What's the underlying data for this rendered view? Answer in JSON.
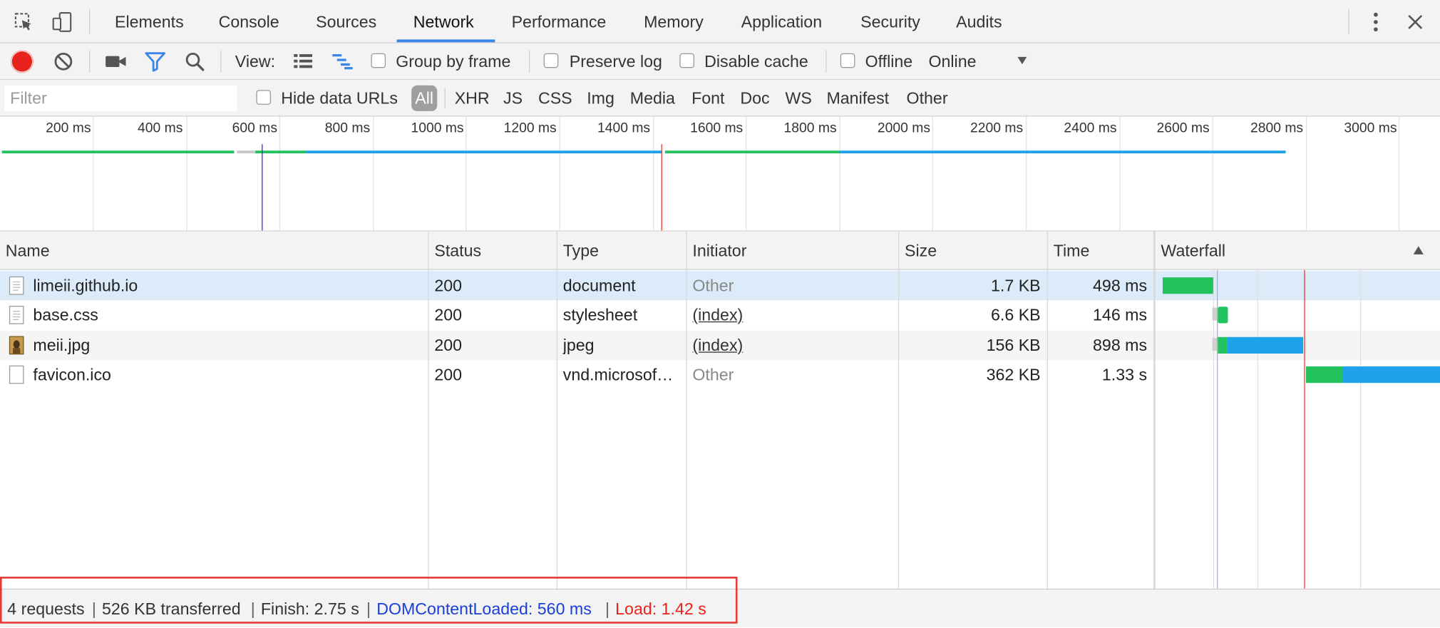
{
  "tabs": [
    "Elements",
    "Console",
    "Sources",
    "Network",
    "Performance",
    "Memory",
    "Application",
    "Security",
    "Audits"
  ],
  "toolbar": {
    "view_label": "View:",
    "group_by_frame": "Group by frame",
    "preserve_log": "Preserve log",
    "disable_cache": "Disable cache",
    "offline": "Offline",
    "throttling": "Online"
  },
  "filter": {
    "placeholder": "Filter",
    "hide_data_urls": "Hide data URLs",
    "types": [
      "All",
      "XHR",
      "JS",
      "CSS",
      "Img",
      "Media",
      "Font",
      "Doc",
      "WS",
      "Manifest",
      "Other"
    ]
  },
  "overview": {
    "ticks": [
      "200 ms",
      "400 ms",
      "600 ms",
      "800 ms",
      "1000 ms",
      "1200 ms",
      "1400 ms",
      "1600 ms",
      "1800 ms",
      "2000 ms",
      "2200 ms",
      "2400 ms",
      "2600 ms",
      "2800 ms",
      "3000 ms"
    ],
    "dom_content_loaded_ms": 560,
    "load_ms": 1420
  },
  "table": {
    "columns": [
      "Name",
      "Status",
      "Type",
      "Initiator",
      "Size",
      "Time",
      "Waterfall"
    ],
    "rows": [
      {
        "name": "limeii.github.io",
        "status": "200",
        "type": "document",
        "initiator": "Other",
        "size": "1.7 KB",
        "time": "498 ms"
      },
      {
        "name": "base.css",
        "status": "200",
        "type": "stylesheet",
        "initiator": "(index)",
        "size": "6.6 KB",
        "time": "146 ms"
      },
      {
        "name": "meii.jpg",
        "status": "200",
        "type": "jpeg",
        "initiator": "(index)",
        "size": "156 KB",
        "time": "898 ms"
      },
      {
        "name": "favicon.ico",
        "status": "200",
        "type": "vnd.microsof…",
        "initiator": "Other",
        "size": "362 KB",
        "time": "1.33 s"
      }
    ]
  },
  "status": {
    "requests": "4 requests",
    "transferred": "526 KB transferred",
    "finish": "Finish: 2.75 s",
    "dom_content_loaded": "DOMContentLoaded: 560 ms",
    "load": "Load: 1.42 s",
    "separator": "|"
  },
  "colors": {
    "accent": "#3a86e8",
    "record": "#e8221c",
    "waiting": "#22c35e",
    "download": "#1fa2ec",
    "dcl_line": "#2a2af0",
    "load_line": "#e53935"
  }
}
